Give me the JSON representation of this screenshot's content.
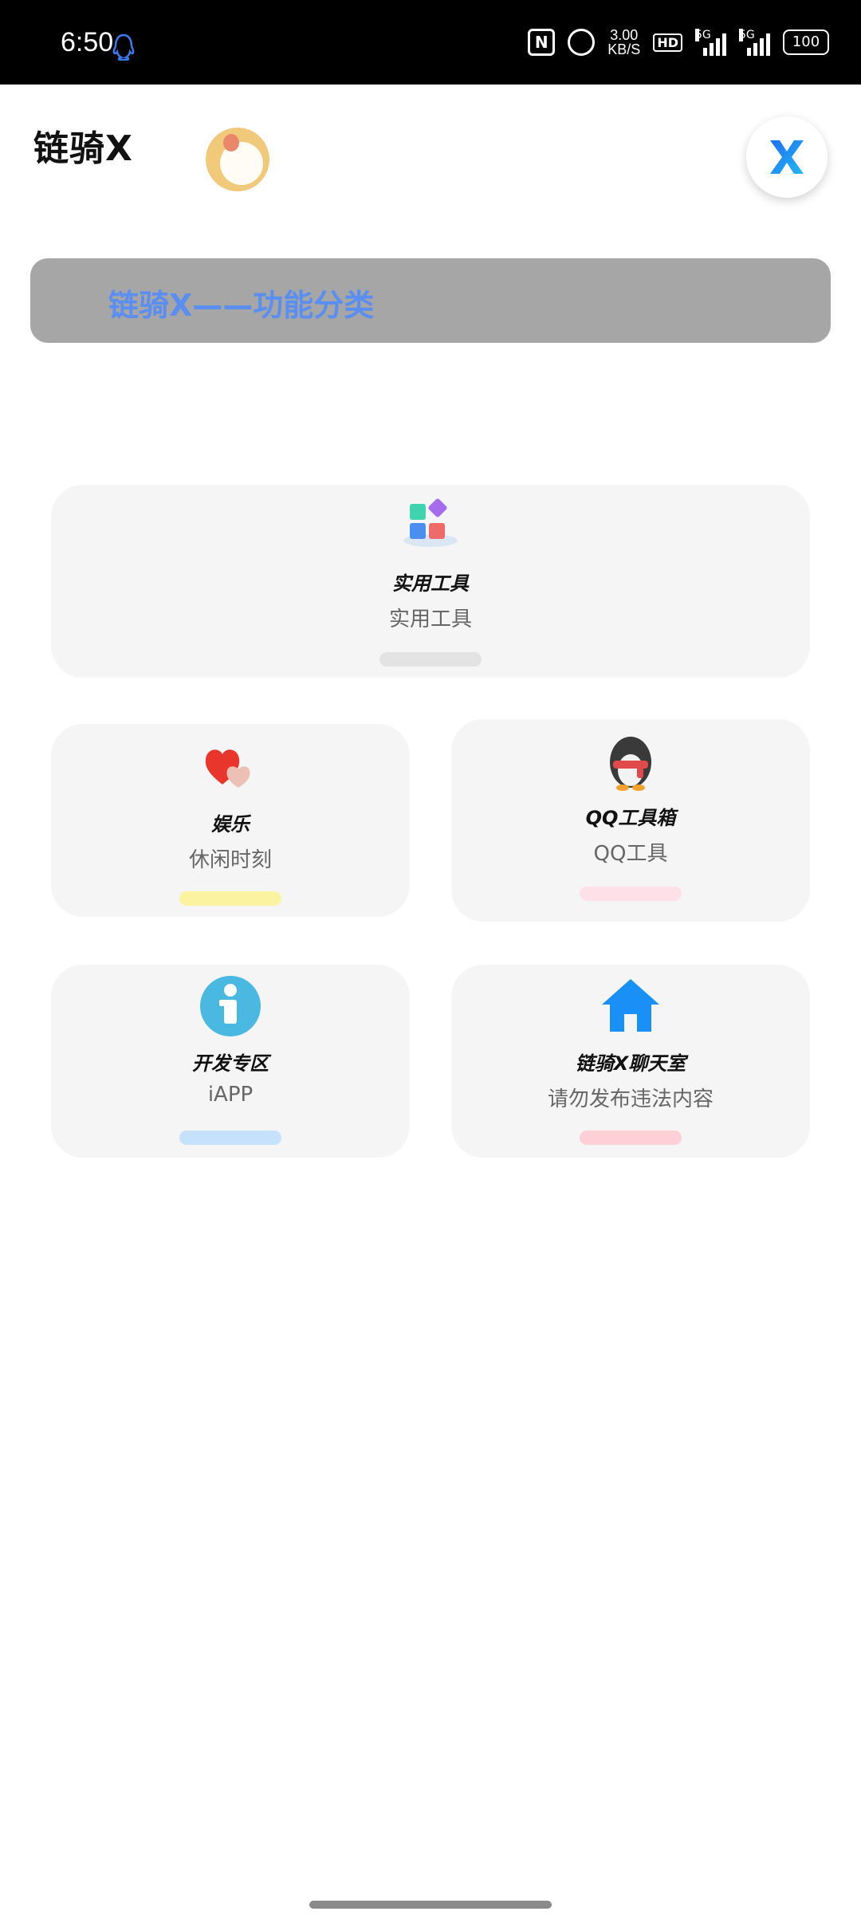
{
  "status_bar": {
    "time": "6:50",
    "speed_value": "3.00",
    "speed_unit": "KB/S",
    "hd_label": "HD",
    "sig1_label": "5G",
    "sig2_label": "5G",
    "battery": "100",
    "nfc_label": "N"
  },
  "header": {
    "title": "链骑X",
    "x_logo_letter": "X"
  },
  "banner": {
    "text": "链骑X——功能分类"
  },
  "cards": [
    {
      "title": "实用工具",
      "subtitle": "实用工具",
      "pill_color": "#e3e3e3",
      "icon": "apps-icon"
    },
    {
      "title": "娱乐",
      "subtitle": "休闲时刻",
      "pill_color": "#fcf3a0",
      "icon": "hearts-icon"
    },
    {
      "title": "QQ工具箱",
      "subtitle": "QQ工具",
      "pill_color": "#fde1e8",
      "icon": "penguin-icon"
    },
    {
      "title": "开发专区",
      "subtitle": "iAPP",
      "pill_color": "#c6e2fa",
      "icon": "info-icon"
    },
    {
      "title": "链骑X聊天室",
      "subtitle": "请勿发布违法内容",
      "pill_color": "#fdd0d8",
      "icon": "home-icon"
    }
  ]
}
